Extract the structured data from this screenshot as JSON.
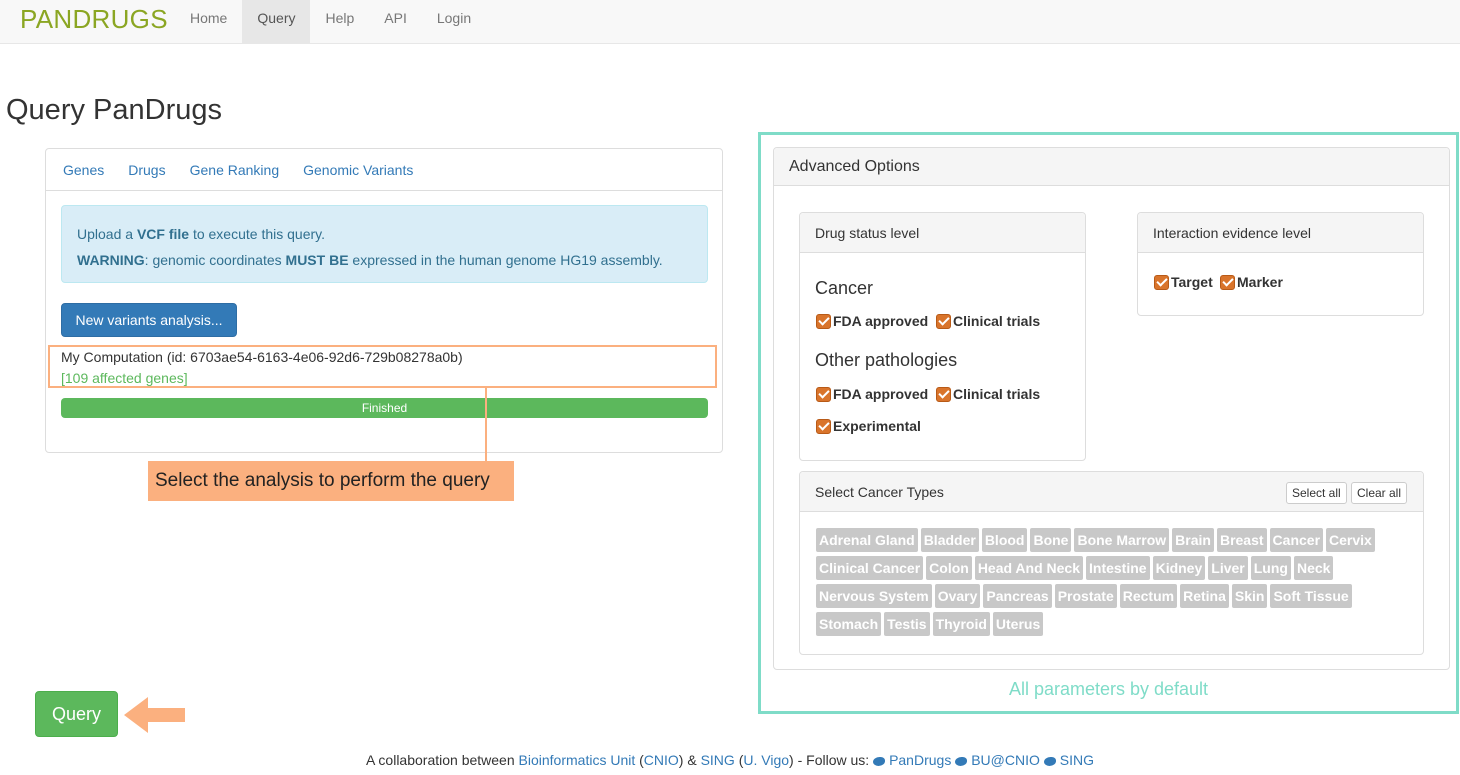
{
  "brand": {
    "part1": "PAN",
    "part2": "DRUGS"
  },
  "nav": [
    {
      "label": "Home"
    },
    {
      "label": "Query"
    },
    {
      "label": "Help"
    },
    {
      "label": "API"
    },
    {
      "label": "Login"
    }
  ],
  "page_title": "Query PanDrugs",
  "tabs": [
    {
      "label": "Genes"
    },
    {
      "label": "Drugs"
    },
    {
      "label": "Gene Ranking"
    },
    {
      "label": "Genomic Variants"
    }
  ],
  "alert": {
    "line1_pre": "Upload a ",
    "line1_bold": "VCF file",
    "line1_post": " to execute this query.",
    "line2_bold1": "WARNING",
    "line2_mid": ": genomic coordinates ",
    "line2_bold2": "MUST BE",
    "line2_post": " expressed in the human genome HG19 assembly."
  },
  "new_analysis_button": "New variants analysis...",
  "computation": {
    "name": "My Computation (id: 6703ae54-6163-4e06-92d6-729b08278a0b)",
    "genes": "[109 affected genes]",
    "status": "Finished",
    "progress_percent": 100
  },
  "callout": "Select the analysis to perform the query",
  "query_button": "Query",
  "advanced": {
    "title": "Advanced Options",
    "drug_status": {
      "title": "Drug status level",
      "cancer_title": "Cancer",
      "cancer_opts": [
        "FDA approved",
        "Clinical trials"
      ],
      "other_title": "Other pathologies",
      "other_opts": [
        "FDA approved",
        "Clinical trials",
        "Experimental"
      ]
    },
    "interaction": {
      "title": "Interaction evidence level",
      "opts": [
        "Target",
        "Marker"
      ]
    },
    "cancer_types": {
      "title": "Select Cancer Types",
      "select_all": "Select all",
      "clear_all": "Clear all",
      "rows": [
        [
          "Adrenal Gland",
          "Bladder",
          "Blood",
          "Bone",
          "Bone Marrow",
          "Brain",
          "Breast",
          "Cancer",
          "Cervix"
        ],
        [
          "Clinical Cancer",
          "Colon",
          "Head And Neck",
          "Intestine",
          "Kidney",
          "Liver",
          "Lung",
          "Neck"
        ],
        [
          "Nervous System",
          "Ovary",
          "Pancreas",
          "Prostate",
          "Rectum",
          "Retina",
          "Skin",
          "Soft Tissue"
        ],
        [
          "Stomach",
          "Testis",
          "Thyroid",
          "Uterus"
        ]
      ]
    }
  },
  "default_note": "All parameters by default",
  "footer": {
    "pre": "A collaboration between ",
    "link1": "Bioinformatics Unit",
    "p1": " (",
    "link2": "CNIO",
    "p2": ") & ",
    "link3": "SING",
    "p3": " (",
    "link4": "U. Vigo",
    "p4": ") - Follow us: ",
    "tw1": "PanDrugs",
    "tw2": "BU@CNIO",
    "tw3": "SING"
  },
  "colors": {
    "brand": "#8ba623",
    "primary": "#337ab7",
    "success": "#5cb85c",
    "annotation_orange": "#fbb07f",
    "annotation_teal": "#7fdcc8",
    "checkbox": "#d9742b"
  }
}
